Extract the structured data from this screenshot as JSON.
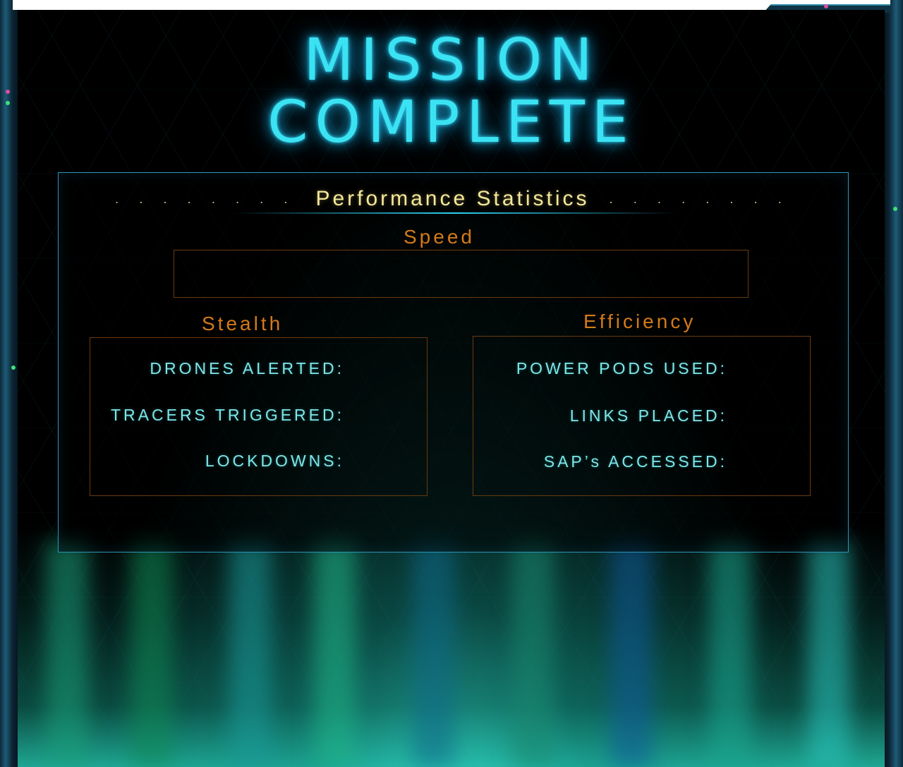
{
  "title": {
    "line1": "MISSION",
    "line2": "COMPLETE"
  },
  "performance": {
    "heading": "Performance Statistics",
    "dots_left": ". . . . . . . .",
    "dots_right": ". . . . . . . ."
  },
  "speed": {
    "heading": "Speed"
  },
  "stealth": {
    "heading": "Stealth",
    "stats": [
      {
        "label": "DRONES ALERTED:"
      },
      {
        "label": "TRACERS TRIGGERED:"
      },
      {
        "label": "LOCKDOWNS:"
      }
    ]
  },
  "efficiency": {
    "heading": "Efficiency",
    "stats": [
      {
        "label": "POWER PODS USED:"
      },
      {
        "label": "LINKS PLACED:"
      },
      {
        "label": "SAP’s ACCESSED:"
      }
    ]
  },
  "colors": {
    "title_glow": "#3be3f2",
    "section_heading": "#d37a18",
    "stat_label": "#7ee6e8",
    "perf_heading": "#f3e79a",
    "panel_border": "#2a95b8"
  }
}
